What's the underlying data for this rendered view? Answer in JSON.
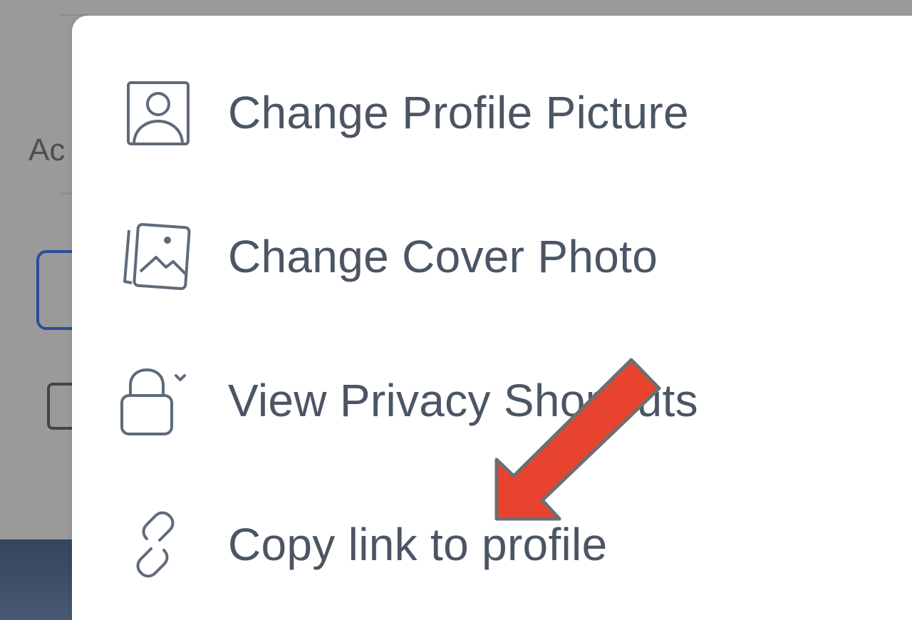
{
  "background": {
    "partial_text": "Ac"
  },
  "menu": {
    "items": [
      {
        "label": "Change Profile Picture",
        "icon": "profile-picture-icon"
      },
      {
        "label": "Change Cover Photo",
        "icon": "cover-photo-icon"
      },
      {
        "label": "View Privacy Shortcuts",
        "icon": "lock-icon"
      },
      {
        "label": "Copy link to profile",
        "icon": "link-icon"
      }
    ]
  },
  "colors": {
    "text": "#4b5563",
    "icon": "#5f6b7a",
    "overlay": "#9a9a9a",
    "arrow": "#e8432f"
  }
}
